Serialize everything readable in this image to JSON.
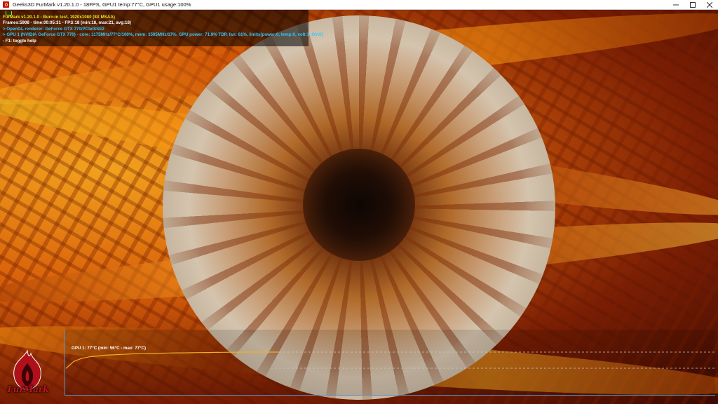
{
  "window": {
    "title": "Geeks3D FurMark v1.20.1.0 - 18FPS, GPU1 temp:77°C, GPU1 usage:100%",
    "icon": "furmark-icon",
    "controls": [
      "minimize",
      "maximize",
      "close"
    ]
  },
  "osd": {
    "line1": "FurMark v1.20.1.0 - Burn-in test, 1920x1080 (8X MSAA)",
    "line2": "Frames:5908 - time:00:05:31 - FPS:18 (min:18, max:21, avg:18)",
    "line3": "> OpenGL renderer: GeForce GTX 770/PCIe/SSE2",
    "line4": "> GPU 1 (NVIDIA GeForce GTX 770) - core: 1175MHz/77°C/100%, mem: 3505MHz/17%, GPU power: 71.9% TDP, fan: 61%, limits[power:0, temp:0, volt:1, OV:0]",
    "line5": "- F1: toggle help"
  },
  "temp_graph": {
    "label": "GPU 1: 77°C (min: 56°C - max: 77°C)",
    "current": 77,
    "min": 56,
    "max": 77,
    "line_color": "#f0b020",
    "samples": [
      56,
      65,
      69,
      71,
      72,
      73,
      73.5,
      74,
      74.5,
      75,
      75,
      75.3,
      75.6,
      75.8,
      76,
      76,
      76.2,
      76.4,
      76.5,
      76.6,
      76.7,
      76.8,
      76.9,
      77,
      77,
      77,
      77,
      77
    ]
  },
  "logo": {
    "text": "FurMark",
    "color": "#c0141b"
  }
}
